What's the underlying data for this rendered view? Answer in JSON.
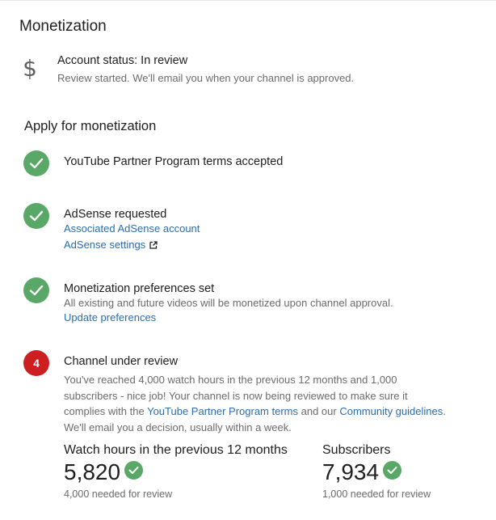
{
  "page": {
    "title": "Monetization"
  },
  "account_status": {
    "icon": "dollar-icon",
    "title": "Account status: In review",
    "subtitle": "Review started. We'll email you when your channel is approved."
  },
  "apply": {
    "title": "Apply for monetization",
    "steps": [
      {
        "status": "done",
        "title": "YouTube Partner Program terms accepted"
      },
      {
        "status": "done",
        "title": "AdSense requested",
        "link1": "Associated AdSense account",
        "link2": "AdSense settings"
      },
      {
        "status": "done",
        "title": "Monetization preferences set",
        "desc": "All existing and future videos will be monetized upon channel approval.",
        "link": "Update preferences"
      },
      {
        "status": "current",
        "number": "4",
        "title": "Channel under review",
        "desc_part1": "You've reached 4,000 watch hours in the previous 12 months and 1,000 subscribers - nice job! Your channel is now being reviewed to make sure it complies with the ",
        "link_terms": "YouTube Partner Program terms",
        "desc_part2": " and our ",
        "link_guidelines": "Community guidelines",
        "desc_part3": ". We'll email you a decision, usually within a week."
      }
    ]
  },
  "stats": [
    {
      "label": "Watch hours in the previous 12 months",
      "value": "5,820",
      "note": "4,000 needed for review"
    },
    {
      "label": "Subscribers",
      "value": "7,934",
      "note": "1,000 needed for review"
    }
  ],
  "colors": {
    "check_green": "#5aa867",
    "step_red": "#cc1f1f",
    "link_blue": "#2b6dad"
  }
}
